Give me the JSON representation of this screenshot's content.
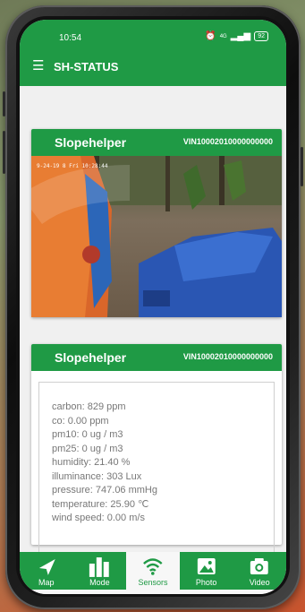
{
  "status": {
    "time": "10:54",
    "signal": "4G",
    "battery": "92"
  },
  "appbar": {
    "title": "SH-STATUS"
  },
  "camera_card": {
    "name": "Slopehelper",
    "vin": "VIN10002010000000000",
    "timestamp": "9-24-19 8 Fri 10:28:44"
  },
  "sensor_card": {
    "name": "Slopehelper",
    "vin": "VIN10002010000000000",
    "readings": [
      "carbon: 829 ppm",
      "co: 0.00 ppm",
      "pm10: 0 ug / m3",
      "pm25: 0 ug / m3",
      "humidity: 21.40 %",
      "illuminance: 303 Lux",
      "pressure: 747.06 mmHg",
      "temperature: 25.90 ℃",
      "wind speed: 0.00 m/s"
    ]
  },
  "nav": {
    "map": "Map",
    "mode": "Mode",
    "sensors": "Sensors",
    "photo": "Photo",
    "video": "Video"
  },
  "colors": {
    "primary": "#1f9a45",
    "background": "#f0f0f0"
  }
}
